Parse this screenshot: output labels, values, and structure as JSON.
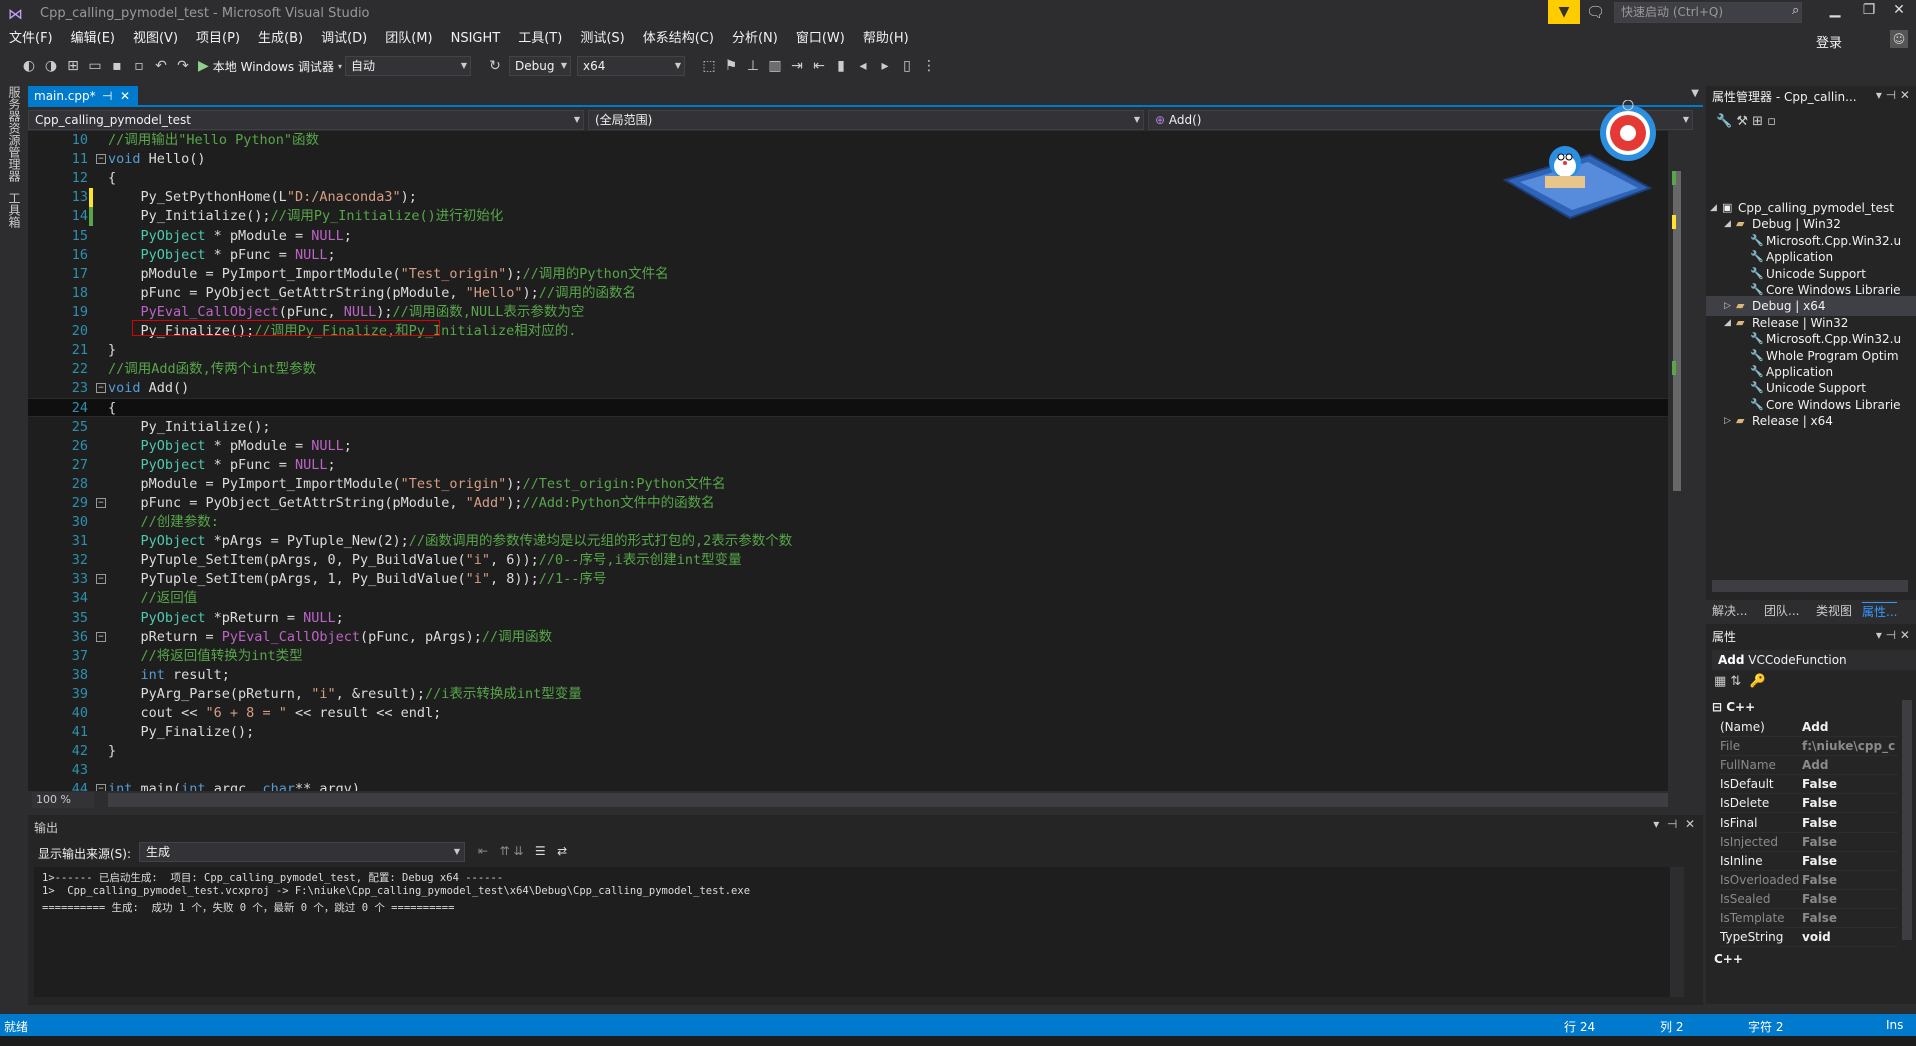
{
  "window": {
    "title": "Cpp_calling_pymodel_test - Microsoft Visual Studio",
    "quick_launch_placeholder": "快速启动 (Ctrl+Q)",
    "filter_icon": "filter-icon",
    "feedback_icon": "feedback-icon"
  },
  "menu": [
    "文件(F)",
    "编辑(E)",
    "视图(V)",
    "项目(P)",
    "生成(B)",
    "调试(D)",
    "团队(M)",
    "NSIGHT",
    "工具(T)",
    "测试(S)",
    "体系结构(C)",
    "分析(N)",
    "窗口(W)",
    "帮助(H)"
  ],
  "login": "登录",
  "toolbar": {
    "run_label": "本地 Windows 调试器",
    "config_auto": "自动",
    "config": "Debug",
    "platform": "x64"
  },
  "left_strip": {
    "server_explorer": "服务器资源管理器",
    "toolbox": "工具箱"
  },
  "editor": {
    "tab_label": "main.cpp*",
    "nav_project": "Cpp_calling_pymodel_test",
    "nav_scope": "(全局范围)",
    "nav_member": "Add()",
    "zoom": "100 %"
  },
  "code_lines": [
    {
      "n": "10",
      "html": "<span class='c'>//调用输出\"Hello Python\"函数</span>"
    },
    {
      "n": "11",
      "fold": "⊟",
      "html": "<span class='k'>void</span> Hello()"
    },
    {
      "n": "12",
      "html": "{"
    },
    {
      "n": "13",
      "chg": "#ffe12e",
      "html": "    Py_SetPythonHome(L<span class='s'>\"D:/Anaconda3\"</span>);"
    },
    {
      "n": "14",
      "chg": "#57a64a",
      "html": "    Py_Initialize();<span class='c'>//调用Py_Initialize()进行初始化</span>"
    },
    {
      "n": "15",
      "html": "    <span class='t'>PyObject</span> * pModule = <span class='m'>NULL</span>;"
    },
    {
      "n": "16",
      "html": "    <span class='t'>PyObject</span> * pFunc = <span class='m'>NULL</span>;"
    },
    {
      "n": "17",
      "html": "    pModule = PyImport_ImportModule(<span class='s'>\"Test_origin\"</span>);<span class='c'>//调用的Python文件名</span>"
    },
    {
      "n": "18",
      "html": "    pFunc = PyObject_GetAttrString(pModule, <span class='s'>\"Hello\"</span>);<span class='c'>//调用的函数名</span>"
    },
    {
      "n": "19",
      "html": "    <span class='m'>PyEval_CallObject</span>(pFunc, <span class='m'>NULL</span>);<span class='c'>//调用函数,NULL表示参数为空</span>"
    },
    {
      "n": "20",
      "html": "    Py_Finalize();<span class='c'>//调用Py_Finalize,和Py_Initialize相对应的.</span>"
    },
    {
      "n": "21",
      "html": "}"
    },
    {
      "n": "22",
      "html": "<span class='c'>//调用Add函数,传两个int型参数</span>"
    },
    {
      "n": "23",
      "fold": "⊟",
      "html": "<span class='k'>void</span> Add()"
    },
    {
      "n": "24",
      "cur": true,
      "html": "{"
    },
    {
      "n": "25",
      "html": "    Py_Initialize();"
    },
    {
      "n": "26",
      "html": "    <span class='t'>PyObject</span> * pModule = <span class='m'>NULL</span>;"
    },
    {
      "n": "27",
      "html": "    <span class='t'>PyObject</span> * pFunc = <span class='m'>NULL</span>;"
    },
    {
      "n": "28",
      "html": "    pModule = PyImport_ImportModule(<span class='s'>\"Test_origin\"</span>);<span class='c'>//Test_origin:Python文件名</span>"
    },
    {
      "n": "29",
      "fold": "⊟",
      "html": "    pFunc = PyObject_GetAttrString(pModule, <span class='s'>\"Add\"</span>);<span class='c'>//Add:Python文件中的函数名</span>"
    },
    {
      "n": "30",
      "html": "    <span class='c'>//创建参数:</span>"
    },
    {
      "n": "31",
      "html": "    <span class='t'>PyObject</span> *pArgs = PyTuple_New(2);<span class='c'>//函数调用的参数传递均是以元组的形式打包的,2表示参数个数</span>"
    },
    {
      "n": "32",
      "html": "    PyTuple_SetItem(pArgs, 0, Py_BuildValue(<span class='s'>\"i\"</span>, 6));<span class='c'>//0--序号,i表示创建int型变量</span>"
    },
    {
      "n": "33",
      "fold": "⊟",
      "html": "    PyTuple_SetItem(pArgs, 1, Py_BuildValue(<span class='s'>\"i\"</span>, 8));<span class='c'>//1--序号</span>"
    },
    {
      "n": "34",
      "html": "    <span class='c'>//返回值</span>"
    },
    {
      "n": "35",
      "html": "    <span class='t'>PyObject</span> *pReturn = <span class='m'>NULL</span>;"
    },
    {
      "n": "36",
      "fold": "⊟",
      "html": "    pReturn = <span class='m'>PyEval_CallObject</span>(pFunc, pArgs);<span class='c'>//调用函数</span>"
    },
    {
      "n": "37",
      "html": "    <span class='c'>//将返回值转换为int类型</span>"
    },
    {
      "n": "38",
      "html": "    <span class='k'>int</span> result;"
    },
    {
      "n": "39",
      "html": "    PyArg_Parse(pReturn, <span class='s'>\"i\"</span>, &amp;result);<span class='c'>//i表示转换成int型变量</span>"
    },
    {
      "n": "40",
      "html": "    cout &lt;&lt; <span class='s'>\"6 + 8 = \"</span> &lt;&lt; result &lt;&lt; endl;"
    },
    {
      "n": "41",
      "html": "    Py_Finalize();"
    },
    {
      "n": "42",
      "html": "}"
    },
    {
      "n": "43",
      "html": ""
    },
    {
      "n": "44",
      "fold": "⊟",
      "html": "<span class='k'>int</span> main(<span class='k'>int</span> argc, <span class='k'>char</span>** argv)"
    }
  ],
  "output": {
    "title": "输出",
    "source_label": "显示输出来源(S):",
    "source_value": "生成",
    "lines": [
      "1>------ 已启动生成:  项目: Cpp_calling_pymodel_test, 配置: Debug x64 ------",
      "1>  Cpp_calling_pymodel_test.vcxproj -> F:\\niuke\\Cpp_calling_pymodel_test\\x64\\Debug\\Cpp_calling_pymodel_test.exe",
      "========== 生成:  成功 1 个，失败 0 个，最新 0 个，跳过 0 个 =========="
    ]
  },
  "property_manager": {
    "title": "属性管理器 - Cpp_callin...",
    "tree": [
      {
        "level": 0,
        "exp": "◢",
        "icon": "project",
        "label": "Cpp_calling_pymodel_test"
      },
      {
        "level": 1,
        "exp": "◢",
        "icon": "folder",
        "label": "Debug | Win32"
      },
      {
        "level": 2,
        "icon": "wrench",
        "label": "Microsoft.Cpp.Win32.u"
      },
      {
        "level": 2,
        "icon": "wrench",
        "label": "Application"
      },
      {
        "level": 2,
        "icon": "wrench",
        "label": "Unicode Support"
      },
      {
        "level": 2,
        "icon": "wrench",
        "label": "Core Windows Librarie"
      },
      {
        "level": 1,
        "exp": "▷",
        "icon": "folder",
        "label": "Debug | x64",
        "selected": true
      },
      {
        "level": 1,
        "exp": "◢",
        "icon": "folder",
        "label": "Release | Win32"
      },
      {
        "level": 2,
        "icon": "wrench",
        "label": "Microsoft.Cpp.Win32.u"
      },
      {
        "level": 2,
        "icon": "wrench",
        "label": "Whole Program Optim"
      },
      {
        "level": 2,
        "icon": "wrench",
        "label": "Application"
      },
      {
        "level": 2,
        "icon": "wrench",
        "label": "Unicode Support"
      },
      {
        "level": 2,
        "icon": "wrench",
        "label": "Core Windows Librarie"
      },
      {
        "level": 1,
        "exp": "▷",
        "icon": "folder",
        "label": "Release | x64"
      }
    ],
    "tabs": [
      "解决...",
      "团队...",
      "类视图",
      "属性..."
    ]
  },
  "properties": {
    "title": "属性",
    "object_name": "Add",
    "object_type": "VCCodeFunction",
    "category": "C++",
    "rows": [
      {
        "k": "(Name)",
        "v": "Add"
      },
      {
        "k": "File",
        "v": "f:\\niuke\\cpp_c",
        "dim": true
      },
      {
        "k": "FullName",
        "v": "Add",
        "dim": true
      },
      {
        "k": "IsDefault",
        "v": "False"
      },
      {
        "k": "IsDelete",
        "v": "False"
      },
      {
        "k": "IsFinal",
        "v": "False"
      },
      {
        "k": "IsInjected",
        "v": "False",
        "dim": true
      },
      {
        "k": "IsInline",
        "v": "False"
      },
      {
        "k": "IsOverloaded",
        "v": "False",
        "dim": true
      },
      {
        "k": "IsSealed",
        "v": "False",
        "dim": true
      },
      {
        "k": "IsTemplate",
        "v": "False",
        "dim": true
      },
      {
        "k": "TypeString",
        "v": "void"
      }
    ],
    "desc": "C++"
  },
  "status": {
    "ready": "就绪",
    "line": "行 24",
    "col": "列 2",
    "char": "字符 2",
    "ins": "Ins"
  }
}
